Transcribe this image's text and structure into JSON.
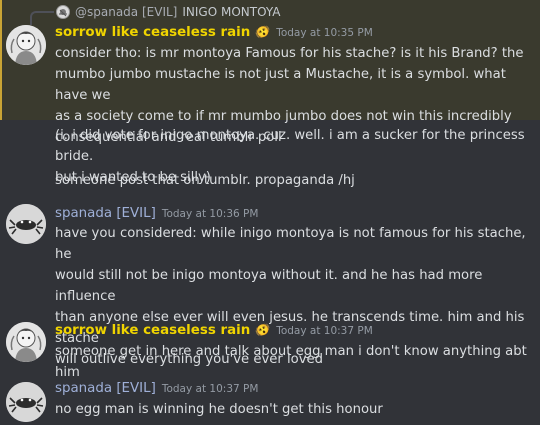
{
  "reply": {
    "author": "@spanada [EVIL]",
    "text": "INIGO MONTOYA"
  },
  "messages": [
    {
      "author": "sorrow like ceaseless rain",
      "badge": "🫨",
      "timestamp": "Today at 10:35 PM",
      "lines": [
        "consider tho: is mr montoya Famous for his stache? is it his Brand? the\nmumbo jumbo mustache is not just a Mustache, it is a symbol. what have we\nas a society come to if mr mumbo jumbo does not win this incredibly\nconsequential and real tumblr poll",
        "(i. i did vote for inigo montoya. cuz. well. i am a sucker for the princess bride.\nbut i wanted to be silly)",
        "someone post that on tumblr. propaganda /hj"
      ]
    },
    {
      "author": "spanada [EVIL]",
      "timestamp": "Today at 10:36 PM",
      "lines": [
        "have you considered: while inigo montoya is not famous for his stache, he\nwould still not be inigo montoya without it. and he has had more influence\nthan anyone else ever will even jesus. he transcends time. him and his stache\nwill outlive everything you've ever loved"
      ]
    },
    {
      "author": "sorrow like ceaseless rain",
      "badge": "🫨",
      "timestamp": "Today at 10:37 PM",
      "lines": [
        "someone get in here and talk about egg man i don't know anything abt him"
      ]
    },
    {
      "author": "spanada [EVIL]",
      "timestamp": "Today at 10:37 PM",
      "lines": [
        "no egg man is winning he doesn't get this honour"
      ]
    }
  ],
  "colors": {
    "background": "#313338",
    "highlight": "#3a3a2e",
    "highlight_bar": "#c9a435",
    "author_gold": "#f0d400",
    "author_blue": "#9fb0d8"
  }
}
